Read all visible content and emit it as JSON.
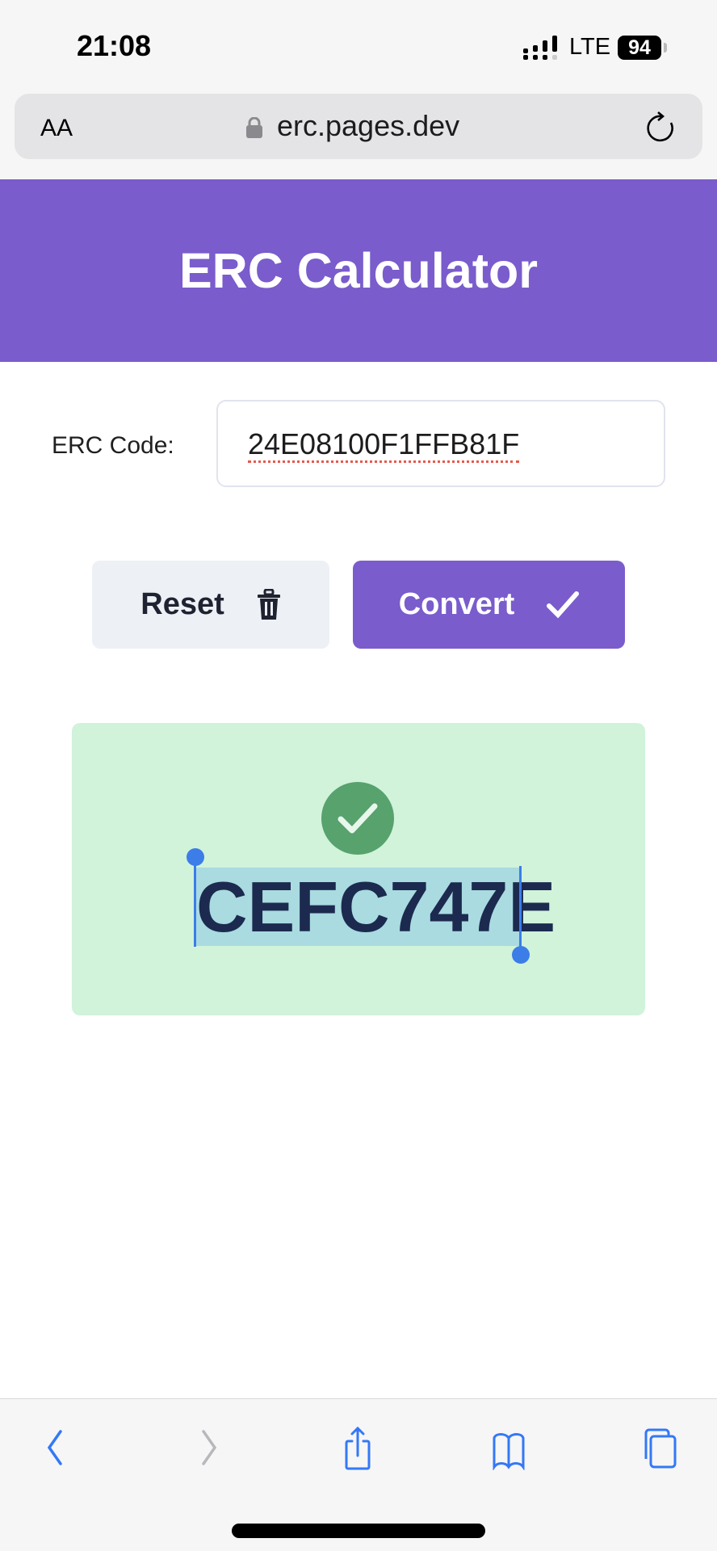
{
  "status_bar": {
    "time": "21:08",
    "network": "LTE",
    "battery": "94"
  },
  "browser": {
    "text_size_label": "AA",
    "url": "erc.pages.dev"
  },
  "app": {
    "title": "ERC Calculator"
  },
  "form": {
    "label": "ERC Code:",
    "value": "24E08100F1FFB81F"
  },
  "buttons": {
    "reset": "Reset",
    "convert": "Convert"
  },
  "result": {
    "code": "CEFC747E",
    "status": "success"
  },
  "colors": {
    "brand": "#7a5ccc",
    "success_bg": "#d0f3da",
    "success_icon": "#57a26d",
    "ios_blue": "#3478f6"
  }
}
